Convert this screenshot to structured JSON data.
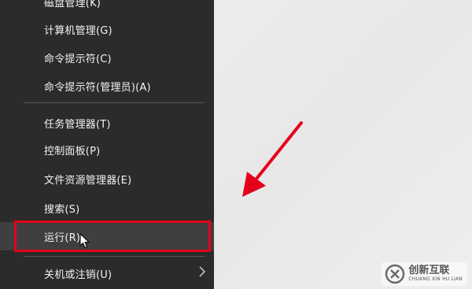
{
  "context_menu": {
    "items": [
      {
        "label": "磁盘管理(K)"
      },
      {
        "label": "计算机管理(G)"
      },
      {
        "label": "命令提示符(C)"
      },
      {
        "label": "命令提示符(管理员)(A)"
      },
      {
        "label": "任务管理器(T)"
      },
      {
        "label": "控制面板(P)"
      },
      {
        "label": "文件资源管理器(E)"
      },
      {
        "label": "搜索(S)"
      },
      {
        "label": "运行(R)",
        "highlighted": true
      },
      {
        "label": "关机或注销(U)",
        "has_submenu": true
      }
    ]
  },
  "annotation": {
    "highlight_color": "#e3001b",
    "arrow_color": "#e3001b"
  },
  "watermark": {
    "title": "创新互联",
    "subtitle": "CHUANG XIN HU LIAN",
    "icon": "cx-logo-icon"
  },
  "colors": {
    "menu_background": "#2b2b2b",
    "menu_text": "#f2f2f2",
    "highlighted_item_background": "#3f3f3f",
    "desktop_background": "#ececec"
  }
}
